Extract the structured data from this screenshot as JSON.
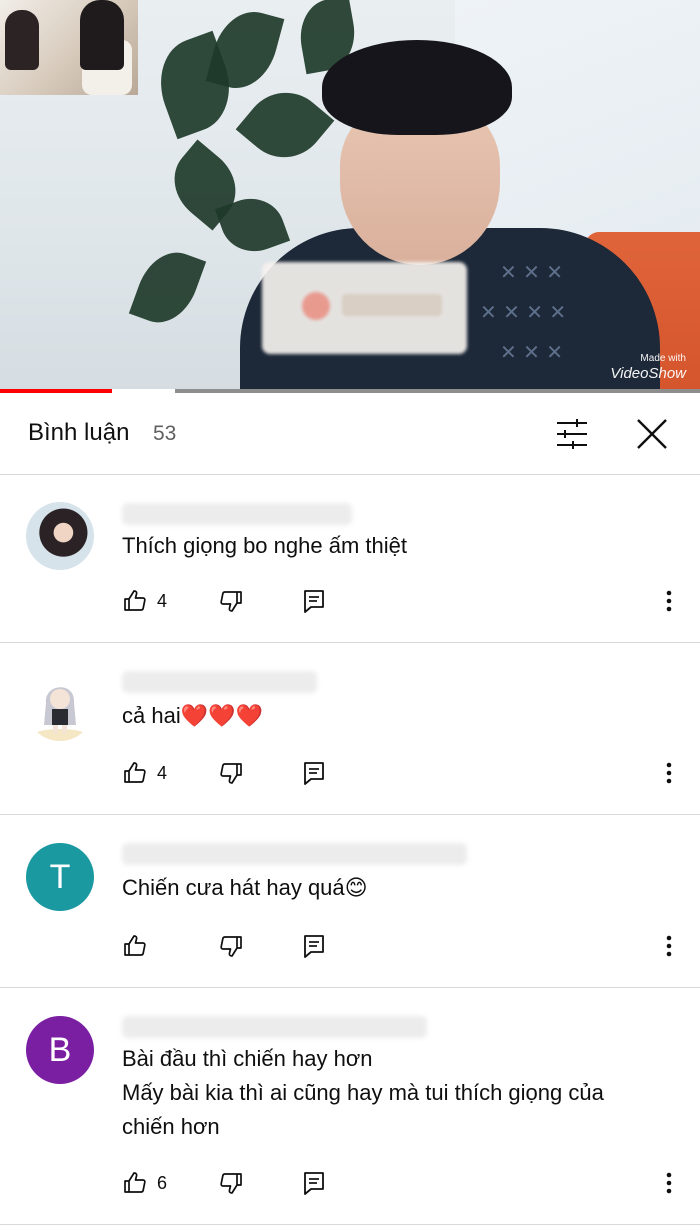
{
  "video": {
    "watermark_small": "Made with",
    "watermark_brand": "VideoShow",
    "progress_played": 0.16,
    "progress_buffered": 0.25
  },
  "comments_header": {
    "title": "Bình luận",
    "count": "53",
    "sort_icon": "tune-icon",
    "close_icon": "close-icon"
  },
  "comments": [
    {
      "avatar_type": "photo",
      "text": "Thích giọng bo nghe ấm thiệt",
      "likes": "4"
    },
    {
      "avatar_type": "anime",
      "text": "cả hai❤️❤️❤️",
      "likes": "4"
    },
    {
      "avatar_type": "letter",
      "avatar_letter": "T",
      "avatar_color": "#1a9aa0",
      "text": "Chiến cưa hát hay quá😊",
      "likes": ""
    },
    {
      "avatar_type": "letter",
      "avatar_letter": "B",
      "avatar_color": "#7b1fa2",
      "text": "Bài đầu thì chiến hay hơn\nMấy bài kia thì ai cũng hay mà tui thích giọng của chiến hơn",
      "likes": "6"
    }
  ],
  "colors": {
    "progress_red": "#ff0000",
    "divider": "#d9d9d9",
    "secondary_text": "#606060"
  }
}
